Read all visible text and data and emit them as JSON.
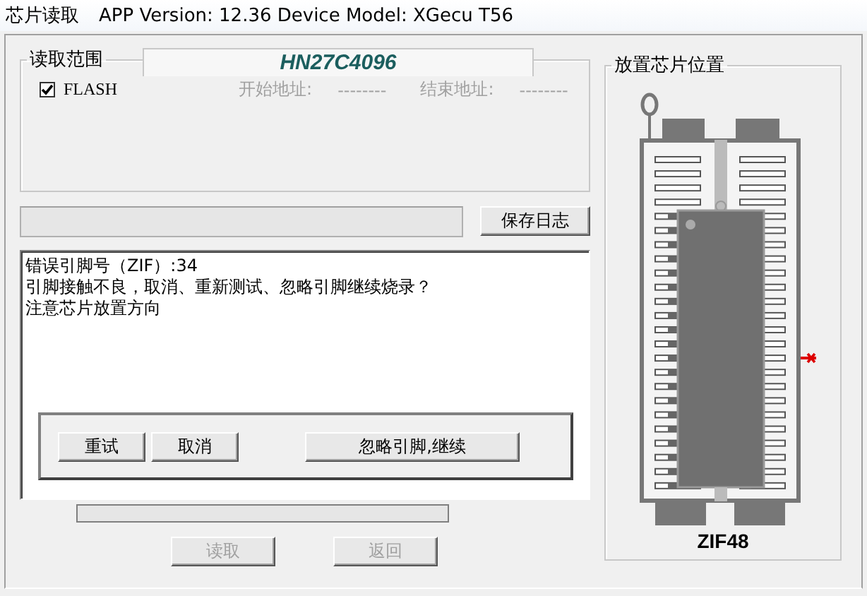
{
  "window": {
    "title": "芯片读取",
    "app_info": "APP Version: 12.36 Device Model: XGecu T56"
  },
  "chip_name": "HN27C4096",
  "read_range": {
    "title": "读取范围",
    "flash": {
      "label": "FLASH",
      "checked": true
    },
    "start_label": "开始地址:",
    "start_value": "--------",
    "end_label": "结束地址:",
    "end_value": "--------",
    "disabled": true
  },
  "save_log_button": "保存日志",
  "log": {
    "lines": [
      "错误引脚号（ZIF）:34",
      "引脚接触不良，取消、重新测试、忽略引脚继续烧录？",
      "注意芯片放置方向"
    ]
  },
  "prompt_buttons": [
    {
      "label": "重试",
      "kind": "normal"
    },
    {
      "label": "取消",
      "kind": "normal"
    },
    {
      "label": "忽略引脚,继续",
      "kind": "wide"
    }
  ],
  "progress": {
    "level": 0
  },
  "buttons": [
    {
      "label": "读取",
      "disabled": true
    },
    {
      "label": "返回",
      "disabled": true
    }
  ],
  "placement": {
    "title": "放置芯片位置",
    "socket": "ZIF48"
  }
}
